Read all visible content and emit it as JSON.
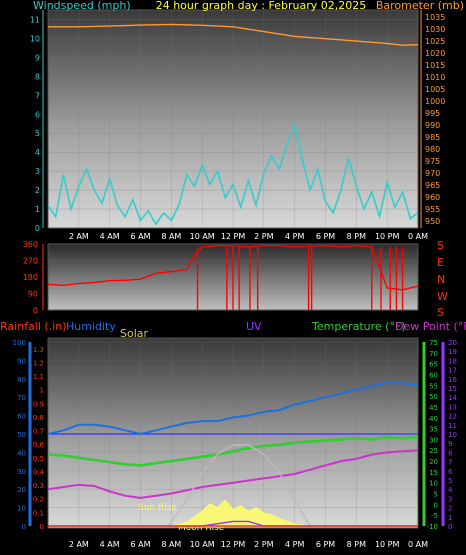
{
  "header": {
    "windspeed_label": "Windspeed (mph)",
    "title": "24 hour graph day : February 02,2025",
    "barometer_label": "Barometer (mb)"
  },
  "bottom_header": {
    "rainfall_label": "Rainfall (.in)",
    "humidity_label": "Humidity",
    "solar_label": "Solar",
    "uv_label": "UV",
    "temperature_label": "Temperature (°F)",
    "dewpoint_label": "Dew Point (°F)"
  },
  "direction_letters": [
    "S",
    "E",
    "N",
    "W",
    "S"
  ],
  "annotations": {
    "sun_rise": "Sun Rise",
    "moon_rise": "Moon Rise"
  },
  "colors": {
    "windspeed": "#33cccc",
    "barometer": "#ff9933",
    "direction": "#ff0000",
    "humidity": "#1e6fe0",
    "temperature": "#33cc33",
    "dewpoint": "#cc33cc",
    "solar": "#ffff66",
    "uv": "#9933ff",
    "rain": "#ff3300",
    "sun_path": "#bbbbbb",
    "baseline": "#3333ff",
    "axis_text": "#ffffff"
  },
  "time_axis": [
    "2 AM",
    "4 AM",
    "6 AM",
    "8 AM",
    "10 AM",
    "12 PM",
    "2 PM",
    "4 PM",
    "6 PM",
    "8 PM",
    "10 PM",
    "0 AM"
  ],
  "chart_data": [
    {
      "type": "line",
      "panel": "wind-barometer",
      "x_unit": "hours",
      "x_range": [
        0,
        24
      ],
      "left_axis": {
        "label": "Windspeed (mph)",
        "ticks": [
          0,
          1,
          2,
          3,
          4,
          5,
          6,
          7,
          8,
          9,
          10,
          11
        ],
        "range": [
          0,
          11.5
        ]
      },
      "right_axis": {
        "label": "Barometer (mb)",
        "ticks": [
          950,
          955,
          960,
          965,
          970,
          975,
          980,
          985,
          990,
          995,
          1000,
          1005,
          1010,
          1015,
          1020,
          1025,
          1030,
          1035
        ],
        "range": [
          947,
          1038
        ]
      },
      "series": [
        {
          "name": "Windspeed (mph)",
          "axis": "left",
          "color_key": "windspeed",
          "points": [
            [
              0,
              1.2
            ],
            [
              0.5,
              0.6
            ],
            [
              1,
              2.8
            ],
            [
              1.5,
              1.0
            ],
            [
              2,
              2.2
            ],
            [
              2.5,
              3.1
            ],
            [
              3,
              2.0
            ],
            [
              3.5,
              1.3
            ],
            [
              4,
              2.6
            ],
            [
              4.5,
              1.2
            ],
            [
              5,
              0.6
            ],
            [
              5.5,
              1.5
            ],
            [
              6,
              0.4
            ],
            [
              6.5,
              0.9
            ],
            [
              7,
              0.2
            ],
            [
              7.5,
              0.8
            ],
            [
              8,
              0.4
            ],
            [
              8.5,
              1.2
            ],
            [
              9,
              2.8
            ],
            [
              9.5,
              2.2
            ],
            [
              10,
              3.3
            ],
            [
              10.5,
              2.3
            ],
            [
              11,
              3.0
            ],
            [
              11.5,
              1.6
            ],
            [
              12,
              2.3
            ],
            [
              12.5,
              1.1
            ],
            [
              13,
              2.5
            ],
            [
              13.5,
              1.2
            ],
            [
              14,
              2.9
            ],
            [
              14.5,
              3.8
            ],
            [
              15,
              3.1
            ],
            [
              15.5,
              4.4
            ],
            [
              16,
              5.4
            ],
            [
              16.5,
              3.6
            ],
            [
              17,
              2.0
            ],
            [
              17.5,
              3.1
            ],
            [
              18,
              1.4
            ],
            [
              18.5,
              0.8
            ],
            [
              19,
              2.0
            ],
            [
              19.5,
              3.7
            ],
            [
              20,
              2.2
            ],
            [
              20.5,
              1.0
            ],
            [
              21,
              1.9
            ],
            [
              21.5,
              0.6
            ],
            [
              22,
              2.4
            ],
            [
              22.5,
              1.1
            ],
            [
              23,
              1.9
            ],
            [
              23.5,
              0.5
            ],
            [
              24,
              0.8
            ]
          ]
        },
        {
          "name": "Barometer (mb)",
          "axis": "right",
          "color_key": "barometer",
          "points": [
            [
              0,
              1031
            ],
            [
              2,
              1031
            ],
            [
              4,
              1031.3
            ],
            [
              6,
              1031.7
            ],
            [
              8,
              1032
            ],
            [
              10,
              1031.6
            ],
            [
              12,
              1031
            ],
            [
              14,
              1029
            ],
            [
              16,
              1027
            ],
            [
              18,
              1026
            ],
            [
              20,
              1025
            ],
            [
              22,
              1024
            ],
            [
              23,
              1023.3
            ],
            [
              24,
              1023.5
            ]
          ]
        }
      ]
    },
    {
      "type": "line",
      "panel": "wind-direction",
      "x_unit": "hours",
      "x_range": [
        0,
        24
      ],
      "y_axis": {
        "ticks": [
          0,
          90,
          180,
          270,
          360
        ],
        "range": [
          0,
          360
        ]
      },
      "series": [
        {
          "name": "Wind direction (deg)",
          "color_key": "direction",
          "points": [
            [
              0,
              140
            ],
            [
              1,
              135
            ],
            [
              2,
              145
            ],
            [
              3,
              150
            ],
            [
              4,
              160
            ],
            [
              5,
              162
            ],
            [
              6,
              168
            ],
            [
              7,
              200
            ],
            [
              8,
              210
            ],
            [
              9,
              220
            ],
            [
              9.5,
              300
            ],
            [
              10,
              345
            ],
            [
              11,
              350
            ],
            [
              12,
              350
            ],
            [
              13,
              345
            ],
            [
              14,
              350
            ],
            [
              15,
              350
            ],
            [
              16,
              345
            ],
            [
              17,
              348
            ],
            [
              18,
              350
            ],
            [
              19,
              345
            ],
            [
              20,
              350
            ],
            [
              21,
              345
            ],
            [
              22,
              120
            ],
            [
              23,
              110
            ],
            [
              24,
              130
            ]
          ]
        }
      ],
      "dips_to_zero_hours": [
        9.7,
        11.6,
        12.0,
        12.4,
        13.1,
        13.6,
        16.9,
        17.1,
        21.0,
        21.6,
        22.2,
        22.6,
        23.0
      ]
    },
    {
      "type": "line",
      "panel": "rain-humidity-temperature",
      "x_unit": "hours",
      "x_range": [
        0,
        24
      ],
      "left_axes": [
        {
          "label": "Humidity",
          "ticks": [
            0,
            10,
            20,
            30,
            40,
            50,
            60,
            70,
            80,
            90,
            100
          ],
          "range": [
            0,
            100
          ]
        },
        {
          "label": "Rainfall (.in)",
          "ticks": [
            0,
            0.1,
            0.2,
            0.3,
            0.4,
            0.5,
            0.6,
            0.7,
            0.8,
            0.9,
            1,
            1.1,
            1.2,
            1.3
          ],
          "range": [
            0,
            1.35
          ]
        }
      ],
      "right_axes": [
        {
          "label": "Temperature (°F)",
          "ticks": [
            -10,
            -5,
            0,
            5,
            10,
            15,
            20,
            25,
            30,
            35,
            40,
            45,
            50,
            55,
            60,
            65,
            70,
            75
          ],
          "range": [
            -10,
            75
          ]
        },
        {
          "label": "UV",
          "ticks": [
            0,
            1,
            2,
            3,
            4,
            5,
            6,
            7,
            8,
            9,
            10,
            11,
            12,
            13,
            14,
            15,
            16,
            17,
            18,
            19,
            20
          ],
          "range": [
            0,
            20
          ]
        }
      ],
      "series": [
        {
          "name": "Humidity",
          "axis": "humidity",
          "color_key": "humidity",
          "points": [
            [
              0,
              50
            ],
            [
              1,
              52
            ],
            [
              2,
              55
            ],
            [
              3,
              55
            ],
            [
              4,
              54
            ],
            [
              5,
              52
            ],
            [
              6,
              50
            ],
            [
              7,
              52
            ],
            [
              8,
              54
            ],
            [
              9,
              56
            ],
            [
              10,
              57
            ],
            [
              11,
              57
            ],
            [
              12,
              59
            ],
            [
              13,
              60
            ],
            [
              14,
              62
            ],
            [
              15,
              63
            ],
            [
              16,
              66
            ],
            [
              17,
              68
            ],
            [
              18,
              70
            ],
            [
              19,
              72
            ],
            [
              20,
              74
            ],
            [
              21,
              76
            ],
            [
              22,
              78
            ],
            [
              23,
              77.5
            ],
            [
              24,
              77
            ]
          ]
        },
        {
          "name": "Temperature (°F)",
          "axis": "temperature",
          "color_key": "temperature",
          "points": [
            [
              0,
              23
            ],
            [
              1,
              22.5
            ],
            [
              2,
              21.5
            ],
            [
              3,
              20.5
            ],
            [
              4,
              19.5
            ],
            [
              5,
              18.5
            ],
            [
              6,
              18
            ],
            [
              7,
              19
            ],
            [
              8,
              20
            ],
            [
              9,
              21
            ],
            [
              10,
              22
            ],
            [
              11,
              23
            ],
            [
              12,
              24.5
            ],
            [
              13,
              26
            ],
            [
              14,
              27
            ],
            [
              15,
              27.5
            ],
            [
              16,
              28.5
            ],
            [
              17,
              29
            ],
            [
              18,
              29.5
            ],
            [
              19,
              30
            ],
            [
              20,
              30.5
            ],
            [
              21,
              30
            ],
            [
              22,
              31
            ],
            [
              23,
              30.5
            ],
            [
              24,
              31
            ]
          ]
        },
        {
          "name": "Dew Point (°F)",
          "axis": "temperature",
          "color_key": "dewpoint",
          "points": [
            [
              0,
              7
            ],
            [
              1,
              8
            ],
            [
              2,
              9
            ],
            [
              3,
              8.5
            ],
            [
              4,
              6
            ],
            [
              5,
              4
            ],
            [
              6,
              3
            ],
            [
              7,
              4
            ],
            [
              8,
              5
            ],
            [
              9,
              6.5
            ],
            [
              10,
              8
            ],
            [
              11,
              9
            ],
            [
              12,
              10
            ],
            [
              13,
              11
            ],
            [
              14,
              12
            ],
            [
              15,
              13
            ],
            [
              16,
              14
            ],
            [
              17,
              16
            ],
            [
              18,
              18
            ],
            [
              19,
              20
            ],
            [
              20,
              21
            ],
            [
              21,
              23
            ],
            [
              22,
              24
            ],
            [
              23,
              24.5
            ],
            [
              24,
              25
            ]
          ]
        },
        {
          "name": "Solar",
          "axis": "solar",
          "color_key": "solar",
          "points": [
            [
              8,
              0
            ],
            [
              9,
              2
            ],
            [
              10,
              8
            ],
            [
              10.5,
              12
            ],
            [
              11,
              10
            ],
            [
              11.5,
              14
            ],
            [
              12,
              9
            ],
            [
              12.5,
              11
            ],
            [
              13,
              8
            ],
            [
              13.5,
              10
            ],
            [
              14,
              7
            ],
            [
              14.5,
              6
            ],
            [
              15,
              4
            ],
            [
              16,
              1
            ],
            [
              17,
              0
            ]
          ]
        },
        {
          "name": "Sun path",
          "axis": "humidity",
          "color_key": "sun_path",
          "points": [
            [
              7.8,
              0
            ],
            [
              9,
              14
            ],
            [
              10,
              29
            ],
            [
              11,
              39
            ],
            [
              12,
              44
            ],
            [
              13,
              44
            ],
            [
              14,
              39
            ],
            [
              15,
              29
            ],
            [
              16,
              14
            ],
            [
              17,
              0
            ]
          ]
        },
        {
          "name": "UV",
          "axis": "uv",
          "color_key": "uv",
          "points": [
            [
              0,
              0
            ],
            [
              10,
              0
            ],
            [
              12,
              0.5
            ],
            [
              13,
              0.5
            ],
            [
              14,
              0
            ],
            [
              24,
              0
            ]
          ]
        },
        {
          "name": "Rainfall (.in)",
          "axis": "rain",
          "color_key": "rain",
          "points": [
            [
              0,
              0
            ],
            [
              24,
              0
            ]
          ]
        }
      ],
      "reference_line": {
        "axis": "humidity",
        "value": 50
      }
    }
  ]
}
